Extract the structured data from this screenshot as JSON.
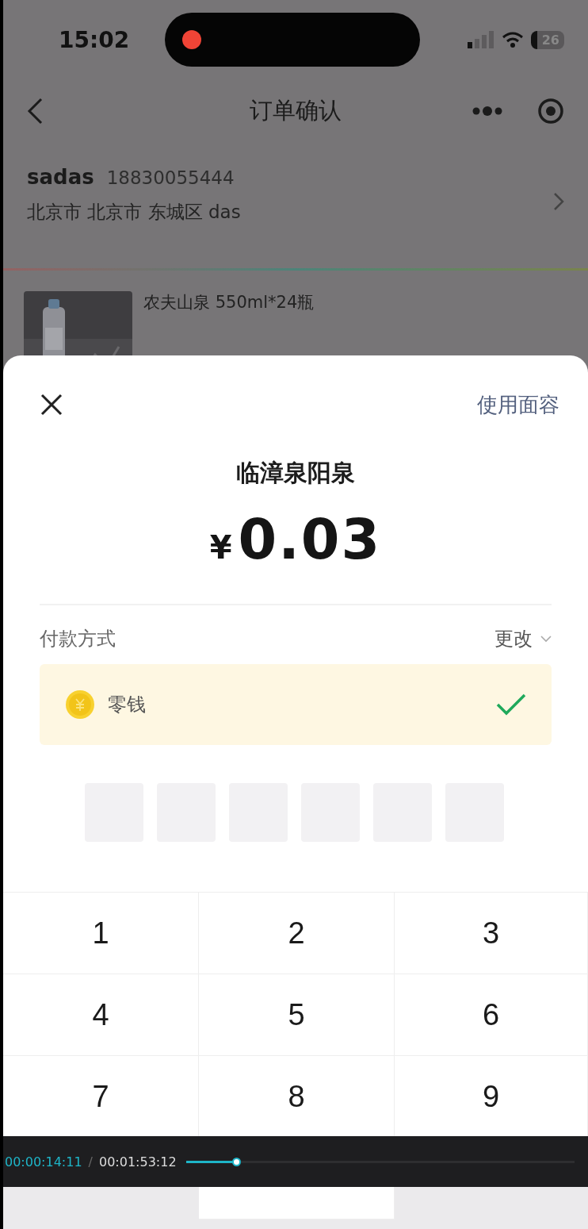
{
  "status_bar": {
    "time": "15:02",
    "battery": "26"
  },
  "nav": {
    "title": "订单确认"
  },
  "address": {
    "name": "sadas",
    "phone": "18830055444",
    "detail": "北京市 北京市 东城区 das"
  },
  "product": {
    "title": "农夫山泉 550ml*24瓶"
  },
  "payment_sheet": {
    "face_id_link": "使用面容",
    "merchant": "临漳泉阳泉",
    "currency": "¥",
    "amount": "0.03",
    "method_label": "付款方式",
    "change": "更改",
    "methods": [
      {
        "name": "零钱",
        "selected": true
      }
    ],
    "pin_digits": [
      {
        "filled": false
      },
      {
        "filled": false
      },
      {
        "filled": false
      },
      {
        "filled": false
      },
      {
        "filled": false
      },
      {
        "filled": false
      }
    ]
  },
  "keypad": {
    "keys": [
      {
        "kind": "digit",
        "label": "1"
      },
      {
        "kind": "digit",
        "label": "2"
      },
      {
        "kind": "digit",
        "label": "3"
      },
      {
        "kind": "digit",
        "label": "4"
      },
      {
        "kind": "digit",
        "label": "5"
      },
      {
        "kind": "digit",
        "label": "6"
      },
      {
        "kind": "digit",
        "label": "7"
      },
      {
        "kind": "digit",
        "label": "8"
      },
      {
        "kind": "digit",
        "label": "9"
      },
      {
        "kind": "blank"
      },
      {
        "kind": "covered"
      },
      {
        "kind": "blank"
      }
    ]
  },
  "video_player": {
    "current": "00:00:14:11",
    "separator": "/",
    "total": "00:01:53:12",
    "level": 0.13
  }
}
